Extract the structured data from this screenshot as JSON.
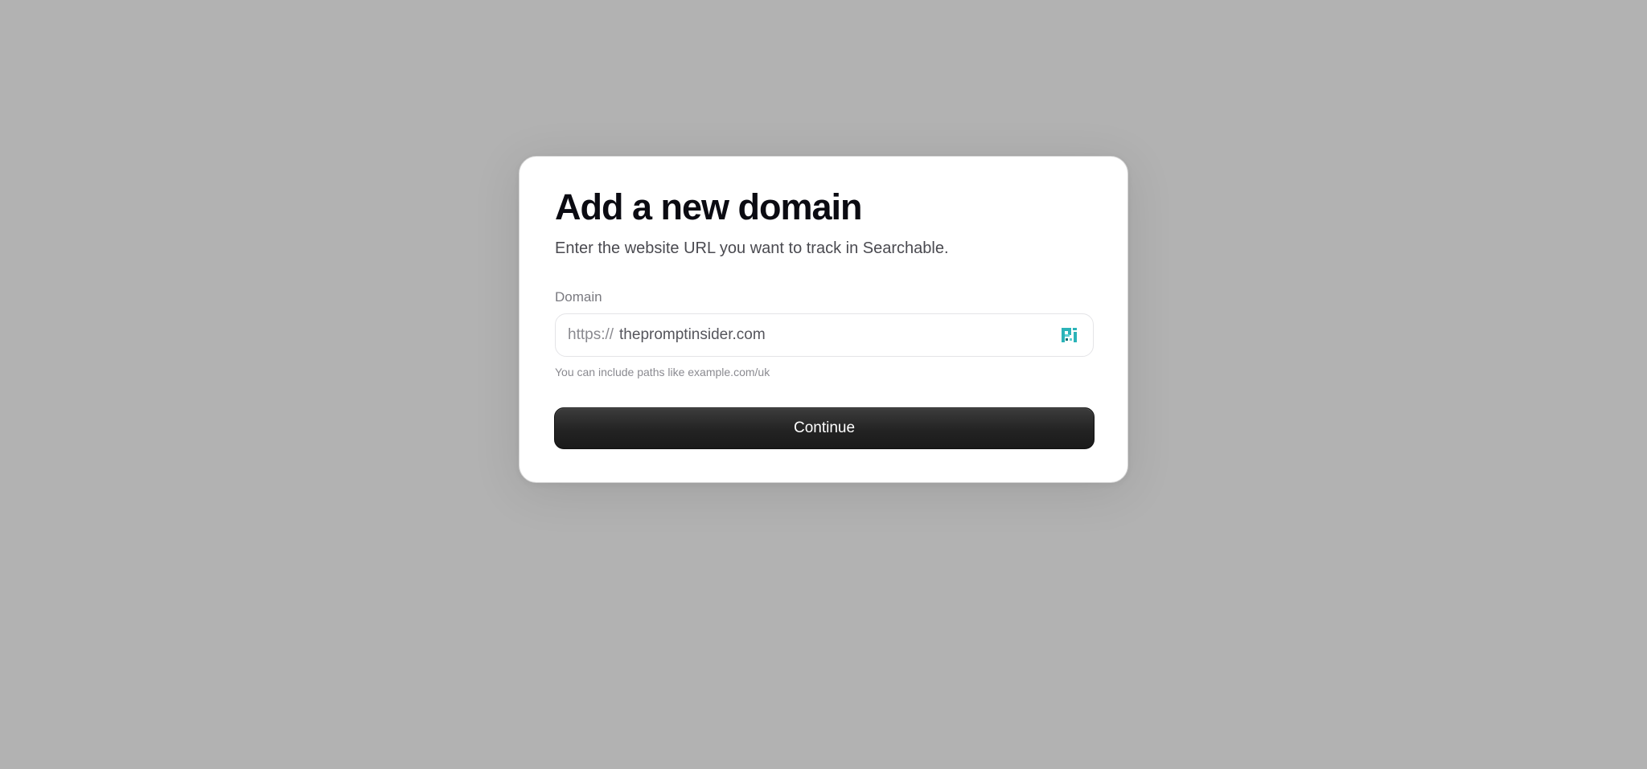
{
  "dialog": {
    "title": "Add a new domain",
    "subtitle": "Enter the website URL you want to track in Searchable.",
    "field_label": "Domain",
    "prefix": "https://",
    "domain_value": "thepromptinsider.com",
    "favicon_icon": "site-favicon-icon",
    "hint": "You can include paths like example.com/uk",
    "continue_label": "Continue"
  },
  "colors": {
    "overlay": "#b2b2b2",
    "card": "#ffffff",
    "button": "#232323",
    "favicon_teal": "#2bb3b8"
  }
}
